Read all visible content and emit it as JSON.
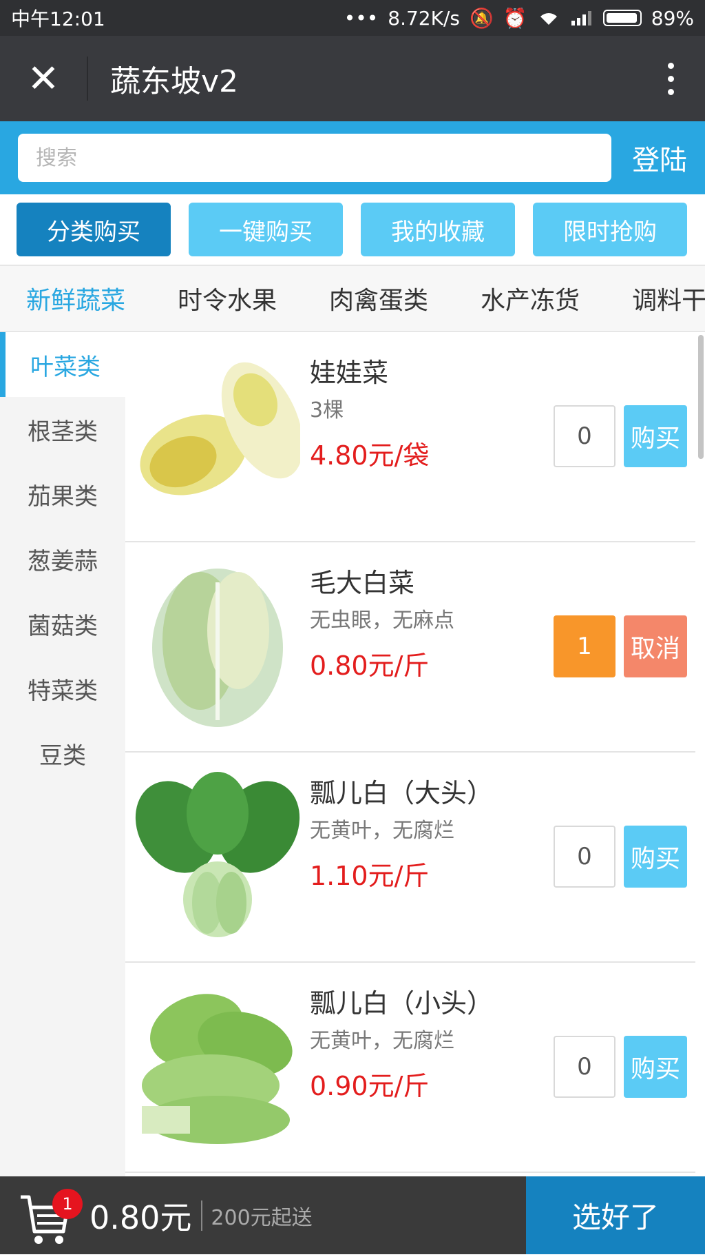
{
  "statusbar": {
    "time": "中午12:01",
    "net_speed": "8.72K/s",
    "battery": "89%",
    "battery_level": 0.89
  },
  "titlebar": {
    "title": "蔬东坡v2"
  },
  "search": {
    "placeholder": "搜索",
    "login_label": "登陆"
  },
  "actions": [
    {
      "label": "分类购买"
    },
    {
      "label": "一键购买"
    },
    {
      "label": "我的收藏"
    },
    {
      "label": "限时抢购"
    }
  ],
  "tabs": [
    {
      "label": "新鲜蔬菜"
    },
    {
      "label": "时令水果"
    },
    {
      "label": "肉禽蛋类"
    },
    {
      "label": "水产冻货"
    },
    {
      "label": "调料干"
    }
  ],
  "sidenav": [
    {
      "label": "叶菜类"
    },
    {
      "label": "根茎类"
    },
    {
      "label": "茄果类"
    },
    {
      "label": "葱姜蒜"
    },
    {
      "label": "菌菇类"
    },
    {
      "label": "特菜类"
    },
    {
      "label": "豆类"
    }
  ],
  "products": [
    {
      "name": "娃娃菜",
      "desc": "3棵",
      "price": "4.80元/袋",
      "qty": "0",
      "button": "购买"
    },
    {
      "name": "毛大白菜",
      "desc": "无虫眼，无麻点",
      "price": "0.80元/斤",
      "qty": "1",
      "button": "取消"
    },
    {
      "name": "瓢儿白（大头）",
      "desc": "无黄叶，无腐烂",
      "price": "1.10元/斤",
      "qty": "0",
      "button": "购买"
    },
    {
      "name": "瓢儿白（小头）",
      "desc": "无黄叶，无腐烂",
      "price": "0.90元/斤",
      "qty": "0",
      "button": "购买"
    }
  ],
  "cart": {
    "badge": "1",
    "total": "0.80元",
    "min_order": "200元起送",
    "done_label": "选好了"
  },
  "colors": {
    "accent": "#29a7e1",
    "price": "#e31d1d",
    "qty_active": "#f8962a",
    "cancel": "#f4876a"
  }
}
